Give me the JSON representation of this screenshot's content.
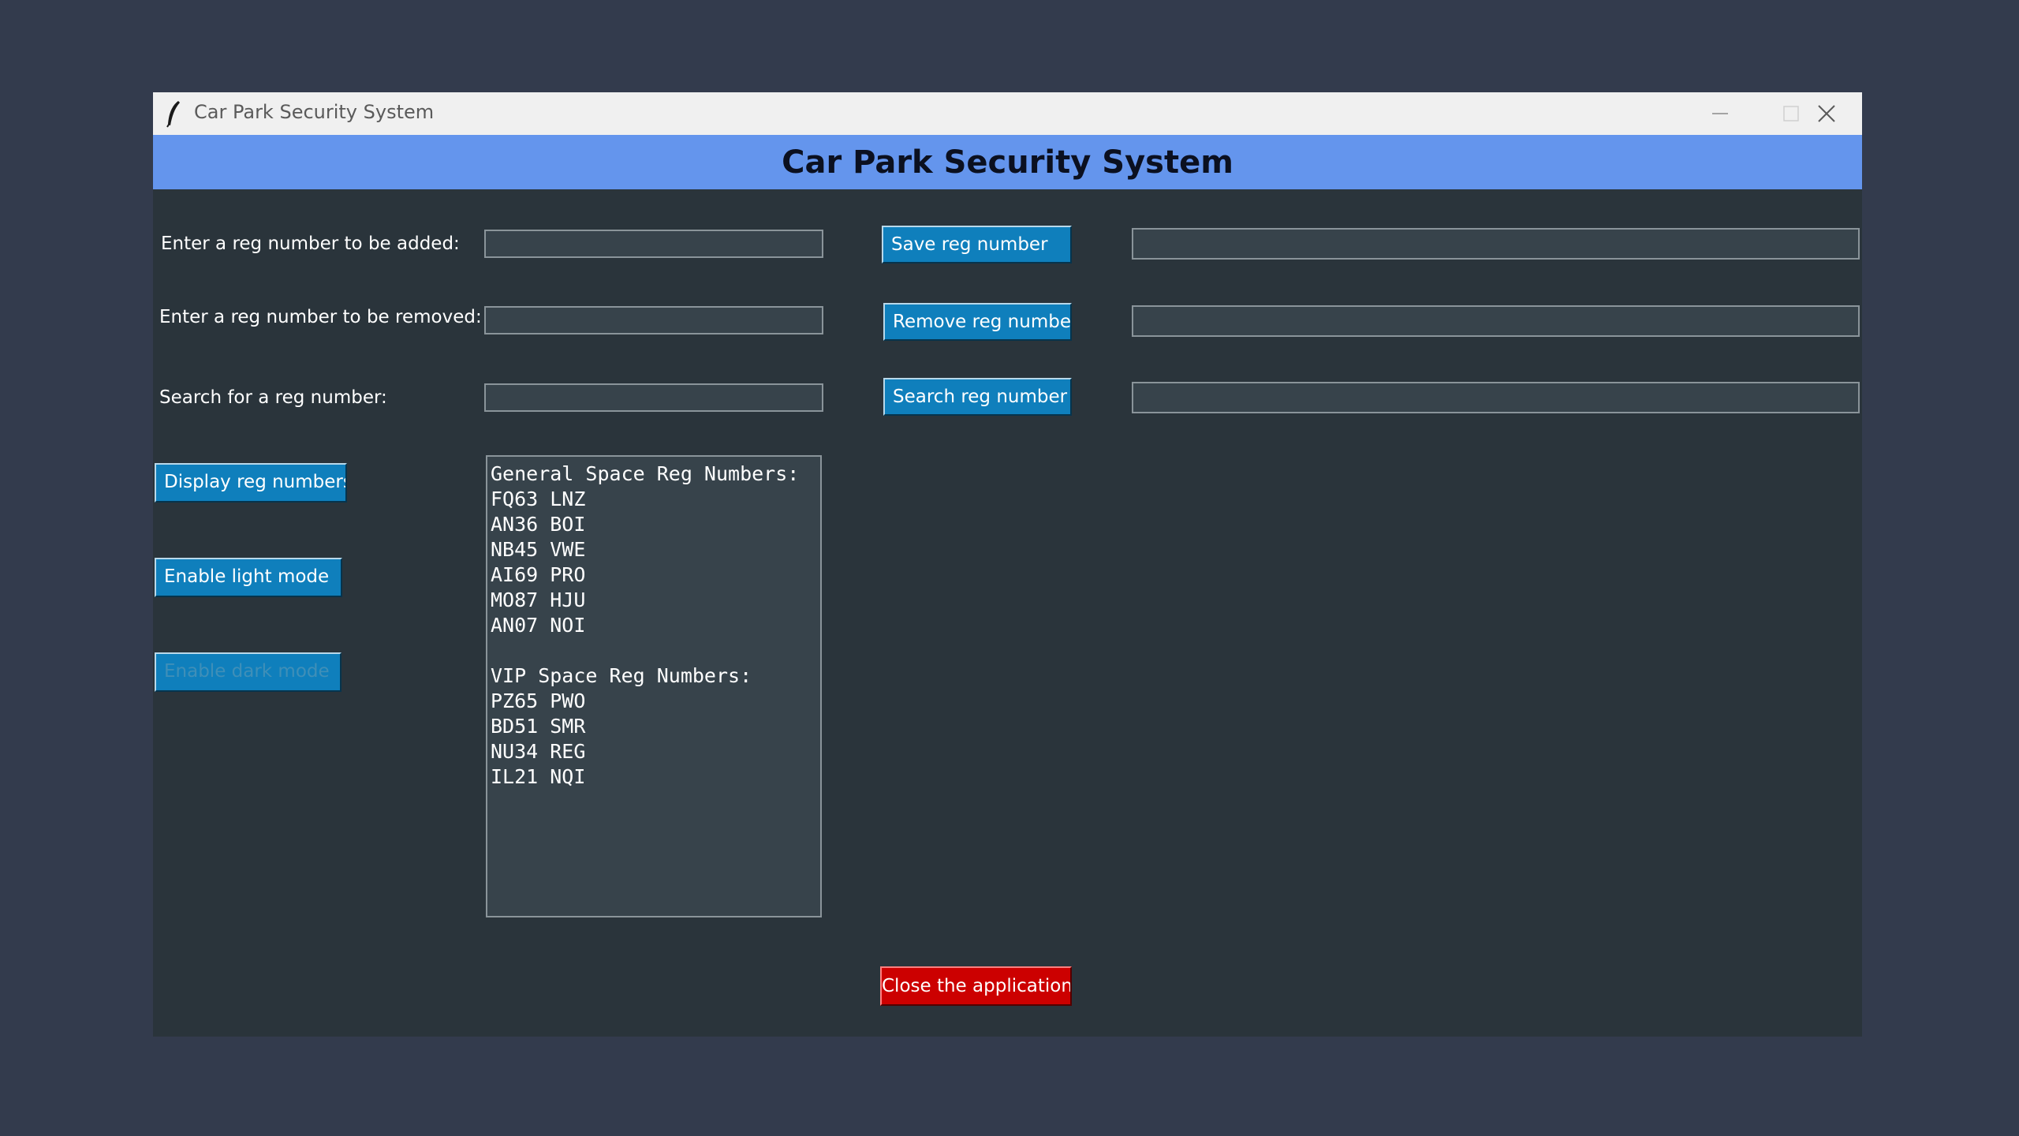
{
  "window": {
    "title": "Car Park Security System",
    "controls": [
      "minimize-icon",
      "maximize-icon",
      "close-icon"
    ]
  },
  "header": {
    "title": "Car Park Security System"
  },
  "rows": {
    "add": {
      "label": "Enter a reg number to be added:",
      "input_value": "",
      "button": "Save reg number",
      "output_value": ""
    },
    "remove": {
      "label": "Enter a reg number to be removed:",
      "input_value": "",
      "button": "Remove reg number",
      "output_value": ""
    },
    "search": {
      "label": "Search for a reg number:",
      "input_value": "",
      "button": "Search reg number",
      "output_value": ""
    }
  },
  "side_buttons": {
    "display": "Display reg numbers",
    "light": "Enable light mode",
    "dark": "Enable dark mode"
  },
  "listbox": {
    "lines": [
      "General Space Reg Numbers:",
      "FQ63 LNZ",
      "AN36 BOI",
      "NB45 VWE",
      "AI69 PRO",
      "MO87 HJU",
      "AN07 NOI",
      "",
      "VIP Space Reg Numbers:",
      "PZ65 PWO",
      "BD51 SMR",
      "NU34 REG",
      "IL21 NQI"
    ]
  },
  "footer": {
    "close_button": "Close the application"
  },
  "colors": {
    "desktop": "#333b4d",
    "window_bg": "#2a343b",
    "header_bg": "#6495ed",
    "button_bg": "#0f7fbc",
    "close_button_bg": "#cc0000"
  }
}
